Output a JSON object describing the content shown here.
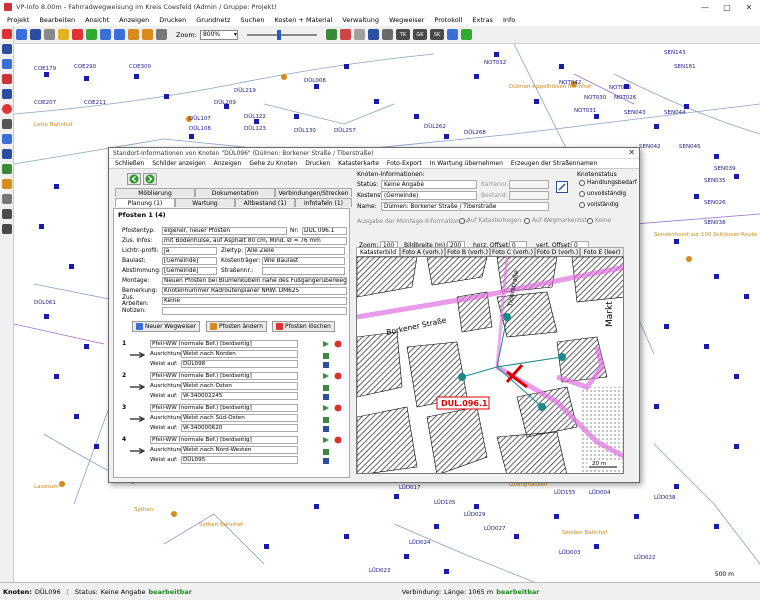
{
  "window": {
    "title": "VP-Info 8.00m - Fahrradwegweisung im Kreis Coesfeld (Admin / Gruppe: Projekt)",
    "controls": [
      "—",
      "□",
      "✕"
    ]
  },
  "menu": [
    "Projekt",
    "Bearbeiten",
    "Ansicht",
    "Anzeigen",
    "Drucken",
    "Grundnetz",
    "Suchen",
    "Kosten + Material",
    "Verwaltung",
    "Wegweiser",
    "Protokoll",
    "Extras",
    "Info"
  ],
  "toolbar": {
    "zoom_label": "Zoom:",
    "zoom_value": "800%",
    "badges": [
      "TK",
      "GK",
      "SK"
    ]
  },
  "dialog": {
    "title": "Standort-Informationen von Knoten \"DÜL096\" (Dülmen: Borkener Straße / Tiberstraße)",
    "menu": [
      "Schließen",
      "Schilder anzeigen",
      "Anzeigen",
      "Gehe zu Knoten",
      "Drucken",
      "Katasterkarte",
      "Foto-Export",
      "In Wartung übernehmen",
      "Erzeugen der Straßennamen"
    ],
    "tabs_row1": [
      "Möblierung",
      "Dokumentation",
      "Verbindungen/Strecken"
    ],
    "tabs_row2": [
      "Planung (1)",
      "Wartung",
      "Altbestand (1)",
      "Infotafeln (1)"
    ],
    "pfosten_heading": "Pfosten 1 (4)",
    "fields": {
      "pfostentyp_label": "Pfostentyp:",
      "pfostentyp_value": "eigener, neuer Pfosten",
      "nr_label": "Nr:",
      "nr_value": "DUL 096.1",
      "zusinfo_label": "Zus. Infos:",
      "zusinfo_value": "mit Bodenhülse, auf Asphalt 80 cm, Mind. Ø = 76 mm",
      "lichtprofil_label": "Lichtr.-profil:",
      "lichtprofil_value": "Ja",
      "zielt_label": "Zieltyp:",
      "zielt_value": "Alle Ziele",
      "baulast_label": "Baulast:",
      "baulast_value": "[Gemeinde]",
      "kostentraeger_label": "Kostenträger:",
      "kostentraeger_value": "Wie Baulast",
      "abstimmung_label": "Abstimmung:",
      "abstimmung_value": "[Gemeinde]",
      "strassennr_label": "Straßennr.:",
      "strassennr_value": "",
      "montage_label": "Montage:",
      "montage_value": "Neuen Pfosten bei Blumenkübeln nahe des Fußgängerüberwegs setzen",
      "bemerkung_label": "Bemerkung:",
      "bemerkung_value": "Knotennummer Radroutenplaner NRW: DM625",
      "zusarbeiten_label": "Zus. Arbeiten:",
      "zusarbeiten_value": "Keine",
      "notizen_label": "Notizen:",
      "notizen_value": ""
    },
    "buttons": {
      "new_sign": "Neuer Wegweiser",
      "change_post": "Pfosten ändern",
      "delete_post": "Pfosten löschen"
    },
    "sign_labels": {
      "ausrichtung": "Ausrichtung:",
      "weistauf": "Weist auf:"
    },
    "signs": [
      {
        "num": "1",
        "type": "Pfeil-WW (normale Bef.) [beidseitig]",
        "ausrichtung": "Weist nach Norden",
        "weistauf": "DÜL098"
      },
      {
        "num": "2",
        "type": "Pfeil-WW (normale Bef.) [beidseitig]",
        "ausrichtung": "Weist nach Osten",
        "weistauf": "W-340002245"
      },
      {
        "num": "3",
        "type": "Pfeil-WW (normale Bef.) [beidseitig]",
        "ausrichtung": "Weist nach Süd-Osten",
        "weistauf": "W-340000620"
      },
      {
        "num": "4",
        "type": "Pfeil-WW (normale Bef.) [beidseitig]",
        "ausrichtung": "Weist nach Nord-Westen",
        "weistauf": "DÜL095"
      }
    ],
    "knoten": {
      "heading": "Knoten-Informationen:",
      "status_label": "Status:",
      "status_value": "Keine Angabe",
      "kostenst_label": "Kostenst.:",
      "kostenst_value": "(Gemeinde)",
      "name_label": "Name:",
      "name_value": "Dülmen: Borkener Straße / Tiberstraße",
      "kartennr_label": "Kartennr.:",
      "bestand_label": "Bestand:",
      "status_heading": "Knotenstatus",
      "radios": [
        "Handlungsbedarf",
        "unvollständig",
        "vollständig"
      ]
    },
    "montage_info": {
      "label": "Ausgabe der Montage-Informationen:",
      "options": [
        "Auf Katasterbogen",
        "Auf Wegmarkenliste",
        "Keine"
      ]
    },
    "map_controls": {
      "zoom_label": "Zoom:",
      "zoom_value": "100",
      "bildbreite_label": "Bildbreite (m):",
      "bildbreite_value": "200",
      "horz_label": "horz. Offset:",
      "horz_value": "0",
      "vert_label": "vert. Offset:",
      "vert_value": "0"
    },
    "photo_tabs": [
      "Katasterbild",
      "Foto A (vorh.)",
      "Foto B (vorh.)",
      "Foto C (vorh.)",
      "Foto D (vorh.)",
      "Foto E (leer)"
    ],
    "minimap": {
      "node_label": "DUL.096.1",
      "street1": "Borkener Straße",
      "street2": "Tiberstraße",
      "street3": "Markt",
      "scale": "20 m"
    }
  },
  "map_labels": [
    "COE179",
    "COE290",
    "COE300",
    "DÜL008",
    "NOT032",
    "NOT042",
    "SEN143",
    "SEN181",
    "COE207",
    "COE211",
    "DÜL219",
    "DÜL209",
    "NOT030",
    "NOT031",
    "NOT025",
    "NOT026",
    "Lette Bahnhof",
    "DÜL107",
    "DÜL108",
    "DÜL122",
    "DÜL123",
    "DÜL130",
    "DÜL257",
    "DÜL262",
    "DÜL268",
    "SEN043",
    "SEN044",
    "SEN042",
    "SEN045",
    "SEN039",
    "SEN035",
    "SEN026",
    "SEN038",
    "DÜL061",
    "Lavesum",
    "Sythen",
    "Sythen Bahnhof",
    "LÜD023",
    "LÜD024",
    "LÜD017",
    "LÜD155",
    "LÜD004",
    "LÜD038",
    "Lüdinghausen",
    "Senden Bahnhof",
    "Sendenhorst zur 100 Schlösser-Route",
    "LÜD105",
    "LÜD029",
    "LÜD027",
    "LÜD003",
    "LÜD022",
    "Dülmen-Appelhülsen Bahnhof"
  ],
  "status": {
    "knoten_label": "Knoten:",
    "knoten_value": "DÜL096",
    "status_label": "Status:",
    "status_value": "Keine Angabe",
    "edit_state": "bearbeitbar",
    "verbindung_label": "Verbindung:",
    "verbindung_value": "Länge: 1065 m",
    "verbindung_state": "bearbeitbar"
  },
  "scale_bar": "500 m"
}
